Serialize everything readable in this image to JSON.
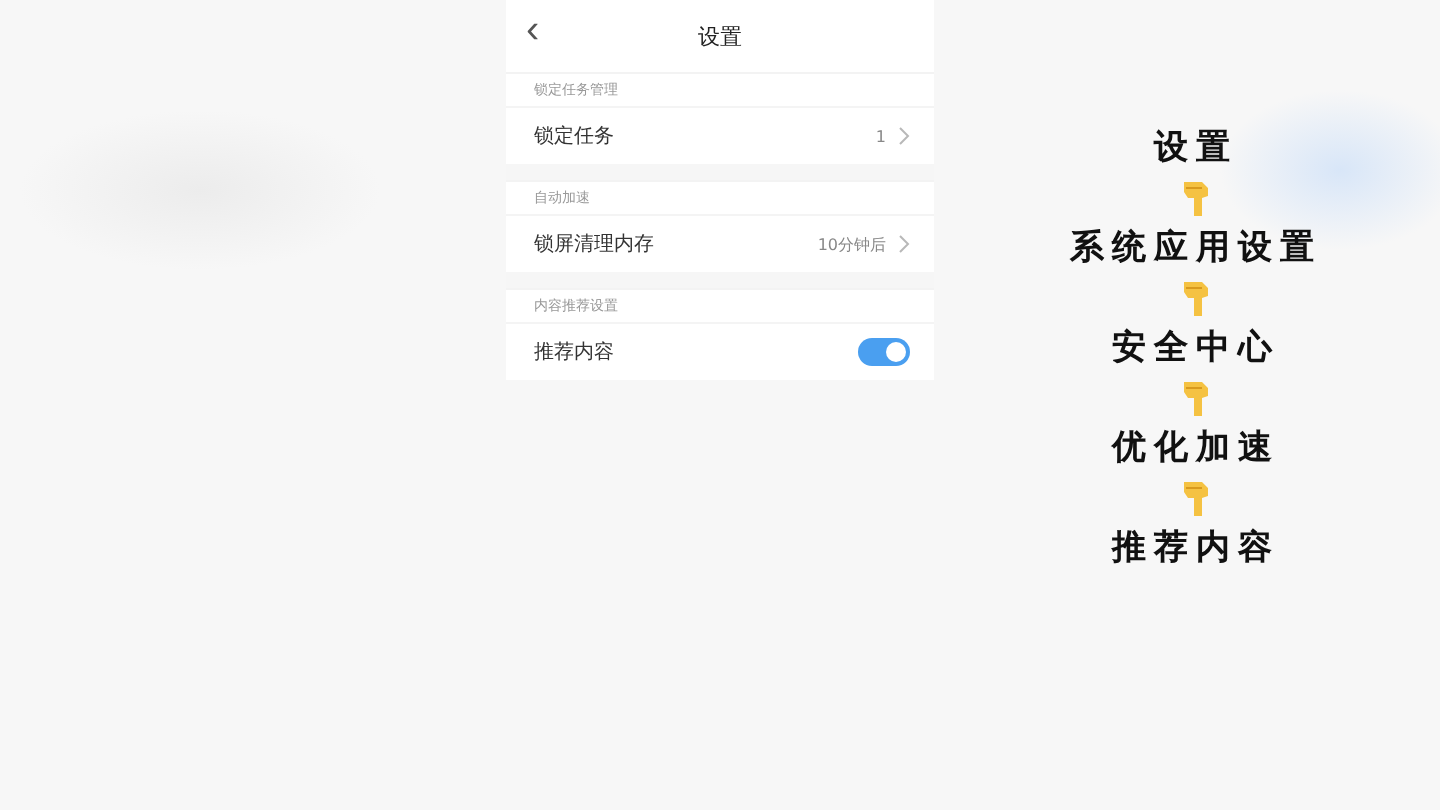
{
  "header": {
    "back": "‹",
    "title": "设置"
  },
  "sections": [
    {
      "header": "锁定任务管理",
      "rows": [
        {
          "kind": "link",
          "label": "锁定任务",
          "value": "1"
        }
      ]
    },
    {
      "header": "自动加速",
      "rows": [
        {
          "kind": "link",
          "label": "锁屏清理内存",
          "value": "10分钟后"
        }
      ]
    },
    {
      "header": "内容推荐设置",
      "rows": [
        {
          "kind": "toggle",
          "label": "推荐内容",
          "on": true
        }
      ]
    }
  ],
  "guide": [
    "设置",
    "系统应用设置",
    "安全中心",
    "优化加速",
    "推荐内容"
  ]
}
